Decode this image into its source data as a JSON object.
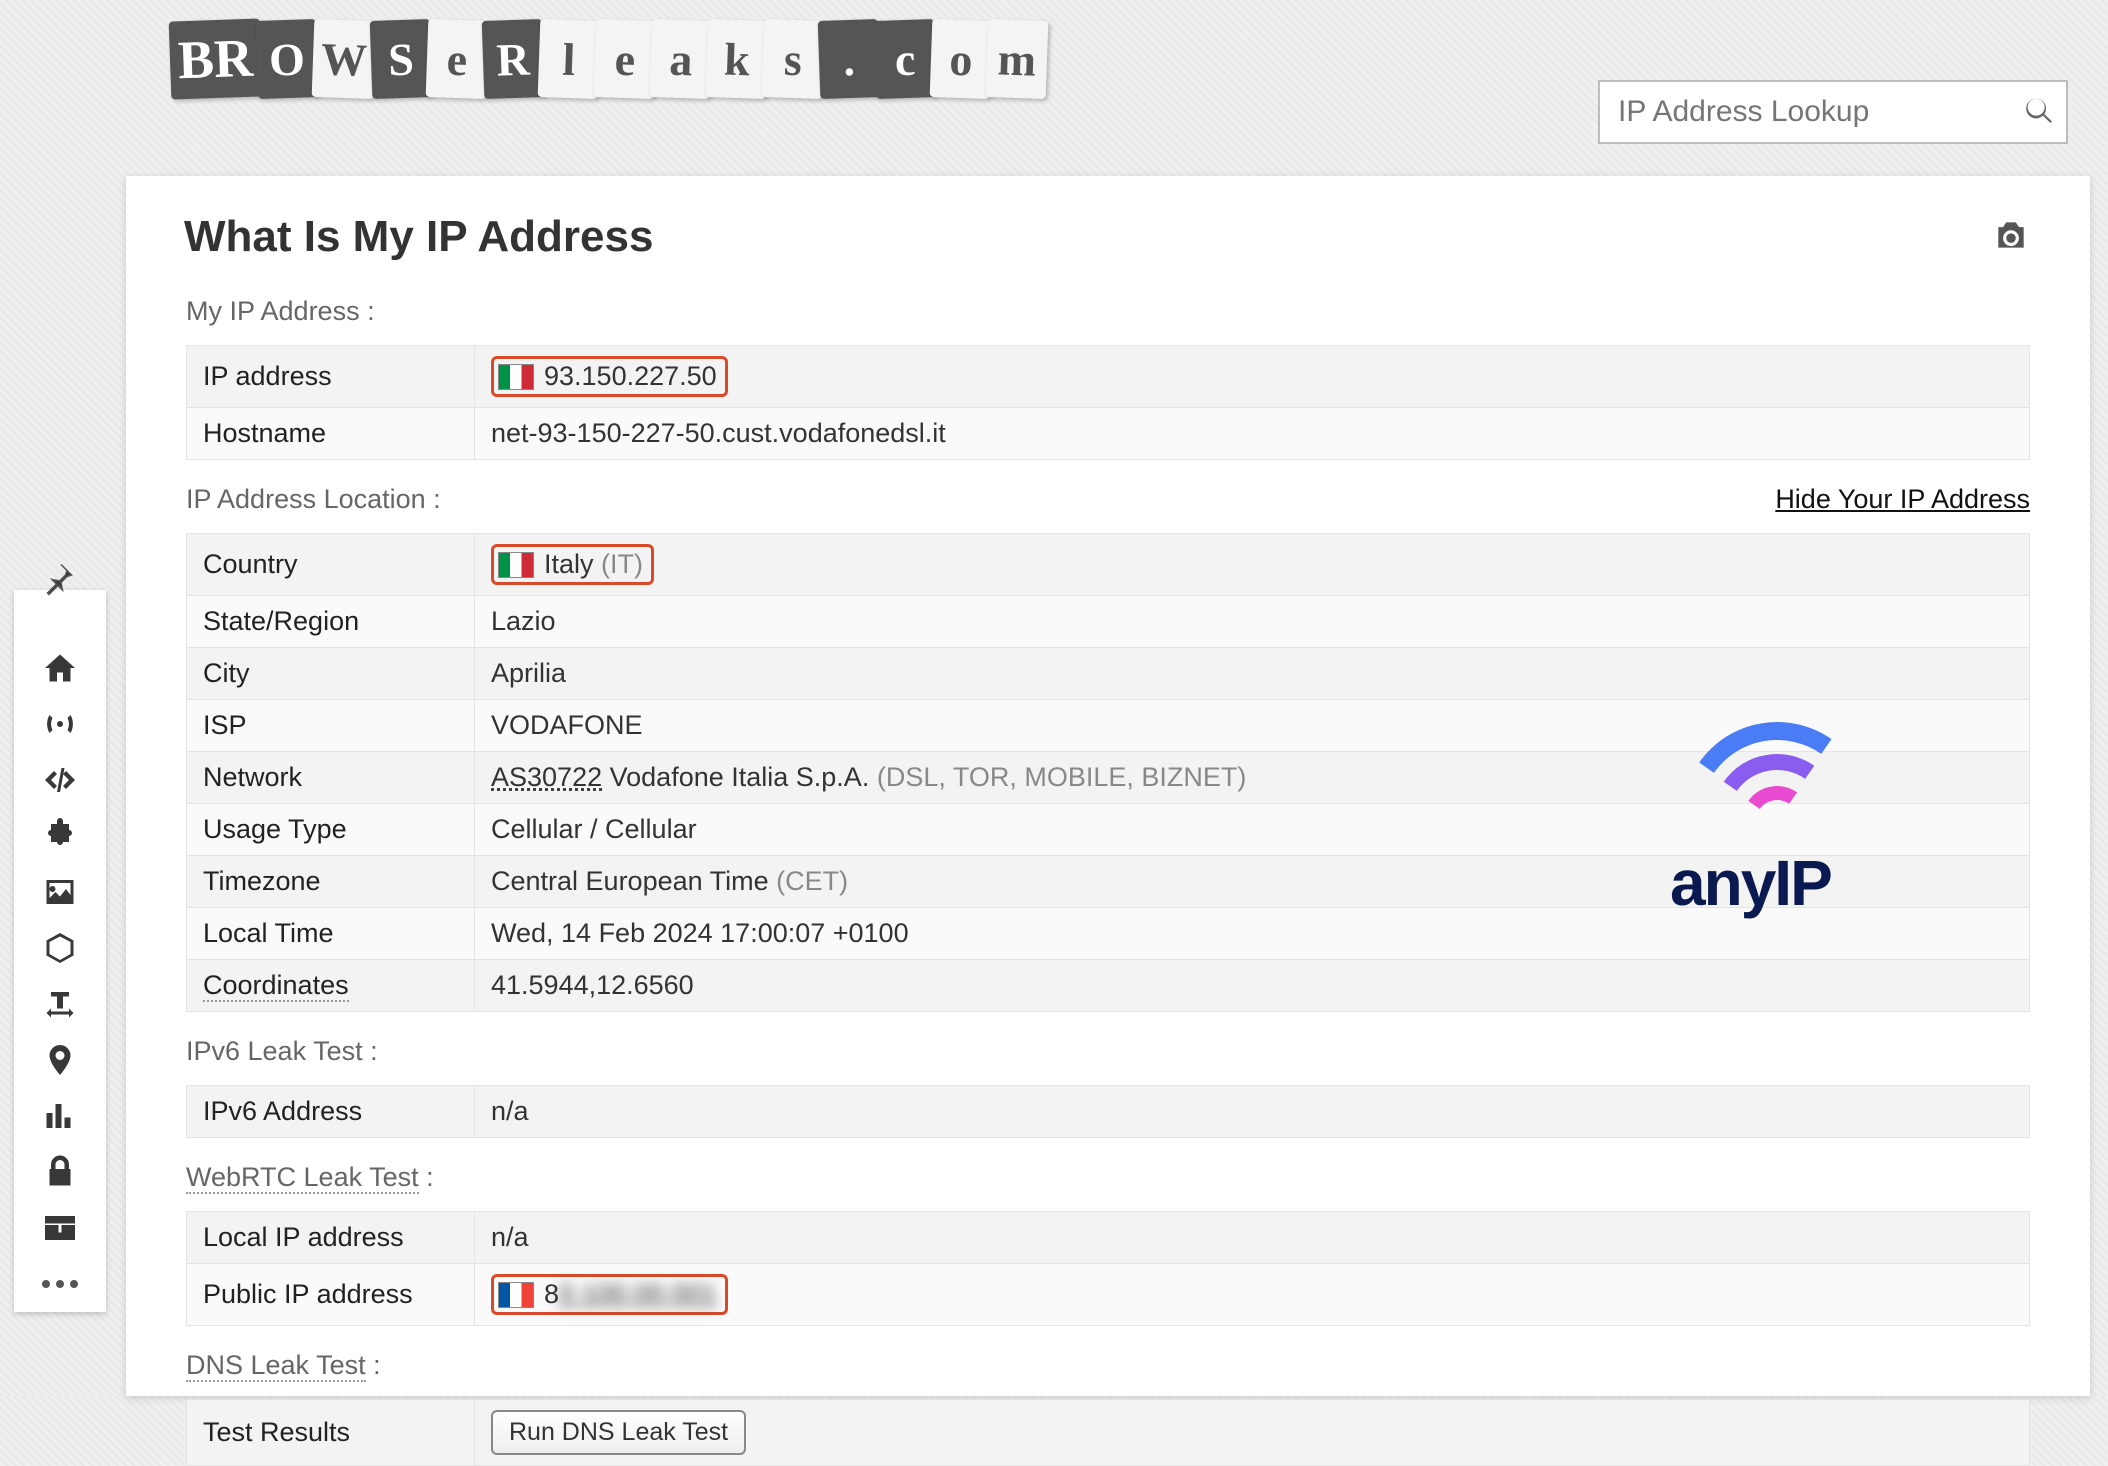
{
  "search": {
    "placeholder": "IP Address Lookup"
  },
  "page_title": "What Is My IP Address",
  "hide_link": "Hide Your IP Address",
  "sections": {
    "ip_head": "My IP Address :",
    "loc_head": "IP Address Location :",
    "v6_head": "IPv6 Leak Test :",
    "rtc_head": "WebRTC Leak Test",
    "dns_head": "DNS Leak Test"
  },
  "ip": {
    "addr_label": "IP address",
    "addr": "93.150.227.50",
    "host_label": "Hostname",
    "host": "net-93-150-227-50.cust.vodafonedsl.it"
  },
  "loc": {
    "country_label": "Country",
    "country": "Italy",
    "country_code": "(IT)",
    "region_label": "State/Region",
    "region": "Lazio",
    "city_label": "City",
    "city": "Aprilia",
    "isp_label": "ISP",
    "isp": "VODAFONE",
    "net_label": "Network",
    "net_as": "AS30722",
    "net_name": "Vodafone Italia S.p.A.",
    "net_tags": "(DSL, TOR, MOBILE, BIZNET)",
    "usage_label": "Usage Type",
    "usage": "Cellular / Cellular",
    "tz_label": "Timezone",
    "tz": "Central European Time",
    "tz_code": "(CET)",
    "time_label": "Local Time",
    "time": "Wed, 14 Feb 2024 17:00:07 +0100",
    "coord_label": "Coordinates",
    "coord": "41.5944,12.6560"
  },
  "v6": {
    "addr_label": "IPv6 Address",
    "addr": "n/a"
  },
  "rtc": {
    "local_label": "Local IP address",
    "local": "n/a",
    "public_label": "Public IP address",
    "public_masked": "8"
  },
  "dns": {
    "result_label": "Test Results",
    "btn": "Run DNS Leak Test"
  },
  "ad": "anyIP"
}
